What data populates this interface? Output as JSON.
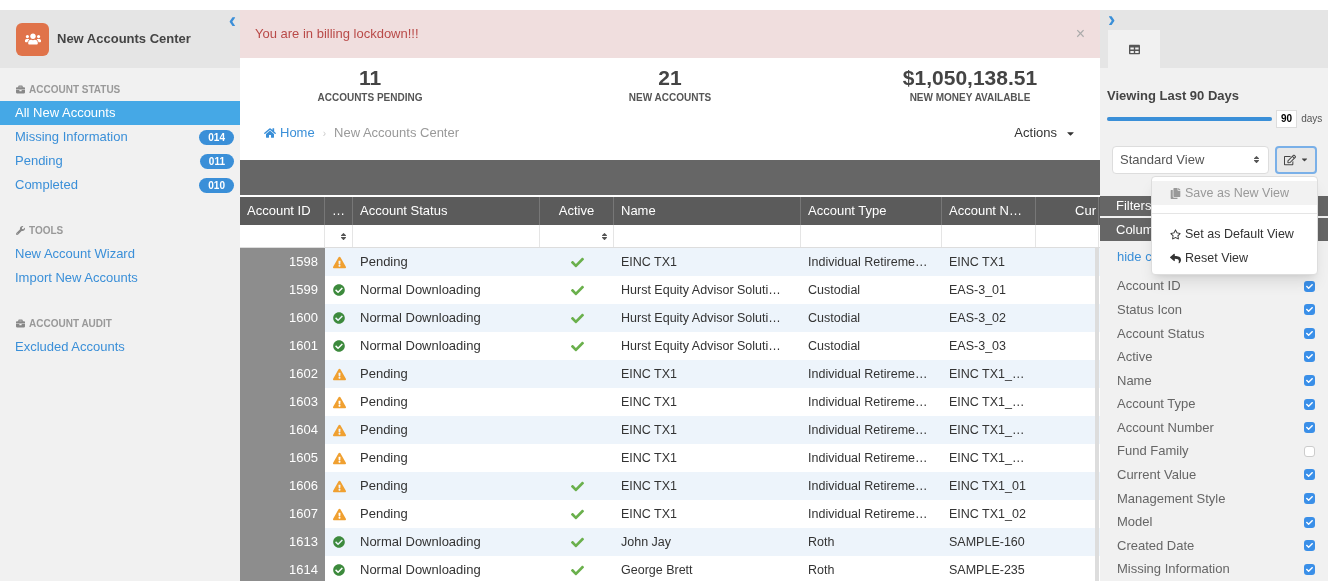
{
  "sidebar": {
    "title": "New Accounts Center",
    "collapse_icon": "‹",
    "sections": [
      {
        "heading": "ACCOUNT STATUS",
        "items": [
          {
            "label": "All New Accounts",
            "selected": true
          },
          {
            "label": "Missing Information",
            "badge": "014",
            "selected": false
          },
          {
            "label": "Pending",
            "badge": "011",
            "selected": false
          },
          {
            "label": "Completed",
            "badge": "010",
            "selected": false
          }
        ]
      },
      {
        "heading": "TOOLS",
        "items": [
          {
            "label": "New Account Wizard",
            "selected": false
          },
          {
            "label": "Import New Accounts",
            "selected": false
          }
        ]
      },
      {
        "heading": "ACCOUNT AUDIT",
        "items": [
          {
            "label": "Excluded Accounts",
            "selected": false
          }
        ]
      }
    ]
  },
  "alert": {
    "message": "You are in billing lockdown!!!",
    "close": "×"
  },
  "stats": [
    {
      "value": "11",
      "label": "ACCOUNTS PENDING"
    },
    {
      "value": "21",
      "label": "NEW ACCOUNTS"
    },
    {
      "value": "$1,050,138.51",
      "label": "NEW MONEY AVAILABLE"
    }
  ],
  "breadcrumb": [
    {
      "label": "Home"
    },
    {
      "label": "New Accounts Center"
    }
  ],
  "breadcrumb_separator": "›",
  "actions": "Actions",
  "table": {
    "columns": [
      "Account ID",
      "…",
      "Account Status",
      "Active",
      "Name",
      "Account Type",
      "Account N…",
      "Cur"
    ],
    "rows": [
      {
        "id": "1598",
        "kind": "warning",
        "status": "Pending",
        "active": true,
        "name": "EINC TX1",
        "type": "Individual Retireme…",
        "number": "EINC TX1"
      },
      {
        "id": "1599",
        "kind": "ok",
        "status": "Normal Downloading",
        "active": true,
        "name": "Hurst Equity Advisor Soluti…",
        "type": "Custodial",
        "number": "EAS-3_01"
      },
      {
        "id": "1600",
        "kind": "ok",
        "status": "Normal Downloading",
        "active": true,
        "name": "Hurst Equity Advisor Soluti…",
        "type": "Custodial",
        "number": "EAS-3_02"
      },
      {
        "id": "1601",
        "kind": "ok",
        "status": "Normal Downloading",
        "active": true,
        "name": "Hurst Equity Advisor Soluti…",
        "type": "Custodial",
        "number": "EAS-3_03"
      },
      {
        "id": "1602",
        "kind": "warning",
        "status": "Pending",
        "active": false,
        "name": "EINC TX1",
        "type": "Individual Retireme…",
        "number": "EINC TX1_…"
      },
      {
        "id": "1603",
        "kind": "warning",
        "status": "Pending",
        "active": false,
        "name": "EINC TX1",
        "type": "Individual Retireme…",
        "number": "EINC TX1_…"
      },
      {
        "id": "1604",
        "kind": "warning",
        "status": "Pending",
        "active": false,
        "name": "EINC TX1",
        "type": "Individual Retireme…",
        "number": "EINC TX1_…"
      },
      {
        "id": "1605",
        "kind": "warning",
        "status": "Pending",
        "active": false,
        "name": "EINC TX1",
        "type": "Individual Retireme…",
        "number": "EINC TX1_…"
      },
      {
        "id": "1606",
        "kind": "warning",
        "status": "Pending",
        "active": true,
        "name": "EINC TX1",
        "type": "Individual Retireme…",
        "number": "EINC TX1_01"
      },
      {
        "id": "1607",
        "kind": "warning",
        "status": "Pending",
        "active": true,
        "name": "EINC TX1",
        "type": "Individual Retireme…",
        "number": "EINC TX1_02"
      },
      {
        "id": "1613",
        "kind": "ok",
        "status": "Normal Downloading",
        "active": true,
        "name": "John Jay",
        "type": "Roth",
        "number": "SAMPLE-160"
      },
      {
        "id": "1614",
        "kind": "ok",
        "status": "Normal Downloading",
        "active": true,
        "name": "George Brett",
        "type": "Roth",
        "number": "SAMPLE-235"
      }
    ]
  },
  "right_panel": {
    "expand_icon": "›",
    "viewing": "Viewing Last 90 Days",
    "days_slider": {
      "level": 1
    },
    "days_value": "90",
    "days_unit": "days",
    "view_select": "Standard View",
    "filters": "Filters",
    "columns_heading": "Colum",
    "hide_link": "hide c",
    "menu": [
      {
        "kind": "item",
        "label": "Save as New View",
        "disabled": true
      },
      {
        "kind": "divider"
      },
      {
        "kind": "item",
        "label": "Set as Default View",
        "disabled": false
      },
      {
        "kind": "item",
        "label": "Reset View",
        "disabled": false
      }
    ],
    "column_toggles": [
      {
        "label": "Account ID",
        "checked": true
      },
      {
        "label": "Status Icon",
        "checked": true
      },
      {
        "label": "Account Status",
        "checked": true
      },
      {
        "label": "Active",
        "checked": true
      },
      {
        "label": "Name",
        "checked": true
      },
      {
        "label": "Account Type",
        "checked": true
      },
      {
        "label": "Account Number",
        "checked": true
      },
      {
        "label": "Fund Family",
        "checked": false
      },
      {
        "label": "Current Value",
        "checked": true
      },
      {
        "label": "Management Style",
        "checked": true
      },
      {
        "label": "Model",
        "checked": true
      },
      {
        "label": "Created Date",
        "checked": true
      },
      {
        "label": "Missing Information",
        "checked": true
      }
    ]
  }
}
